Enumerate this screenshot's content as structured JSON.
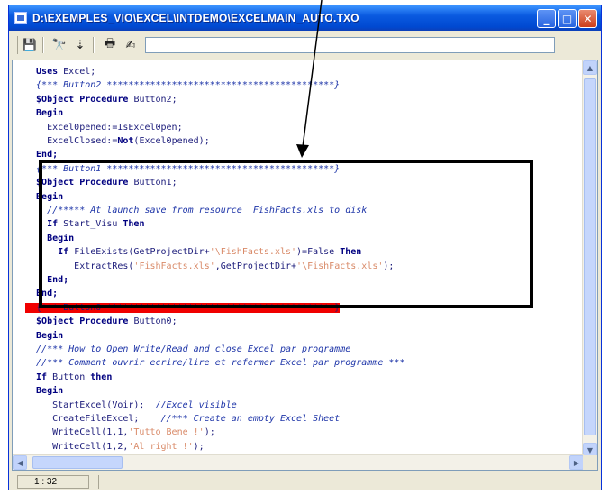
{
  "window": {
    "title": "D:\\EXEMPLES_VIO\\EXCEL\\INTDEMO\\EXCELMAIN_AUTO.TXO"
  },
  "titlebar_buttons": {
    "minimize": "_",
    "maximize": "□",
    "close": "✕"
  },
  "toolbar": {
    "icons": [
      "save-icon",
      "binoculars-icon",
      "find-next-icon",
      "print-icon",
      "edit-tool-icon"
    ],
    "glyphs": {
      "save": "💾",
      "find": "🔭",
      "find_next": "⇣",
      "print": "🖶",
      "tool": "✍"
    }
  },
  "code_lines": [
    [
      {
        "t": "  Uses ",
        "c": "kw"
      },
      {
        "t": "Excel;",
        "c": ""
      }
    ],
    [
      {
        "t": "  {*** Button2 ******************************************}",
        "c": "cm"
      }
    ],
    [
      {
        "t": "  $Object ",
        "c": "kw"
      },
      {
        "t": "Procedure ",
        "c": "kw"
      },
      {
        "t": "Button2;",
        "c": ""
      }
    ],
    [
      {
        "t": "  Begin",
        "c": "kw"
      }
    ],
    [
      {
        "t": "    Excel0pened:=IsExcel0pen;",
        "c": ""
      }
    ],
    [
      {
        "t": "    ExcelClosed:=",
        "c": ""
      },
      {
        "t": "Not",
        "c": "kw"
      },
      {
        "t": "(Excel0pened);",
        "c": ""
      }
    ],
    [
      {
        "t": "  End;",
        "c": "kw"
      }
    ],
    [
      {
        "t": "  {*** Button1 ******************************************}",
        "c": "cm"
      }
    ],
    [
      {
        "t": "  $Object ",
        "c": "kw"
      },
      {
        "t": "Procedure ",
        "c": "kw"
      },
      {
        "t": "Button1;",
        "c": ""
      }
    ],
    [
      {
        "t": "  Begin",
        "c": "kw"
      }
    ],
    [
      {
        "t": "    //***** At launch save from resource  FishFacts.xls to disk",
        "c": "cm"
      }
    ],
    [
      {
        "t": "    If ",
        "c": "kw"
      },
      {
        "t": "Start_Visu ",
        "c": ""
      },
      {
        "t": "Then",
        "c": "kw"
      }
    ],
    [
      {
        "t": "    Begin",
        "c": "kw"
      }
    ],
    [
      {
        "t": "      If ",
        "c": "kw"
      },
      {
        "t": "FileExists(GetProjectDir+",
        "c": ""
      },
      {
        "t": "'\\FishFacts.xls'",
        "c": "str"
      },
      {
        "t": ")=False ",
        "c": ""
      },
      {
        "t": "Then",
        "c": "kw"
      }
    ],
    [
      {
        "t": "         ExtractRes(",
        "c": ""
      },
      {
        "t": "'FishFacts.xls'",
        "c": "str"
      },
      {
        "t": ",GetProjectDir+",
        "c": ""
      },
      {
        "t": "'\\FishFacts.xls'",
        "c": "str"
      },
      {
        "t": ");",
        "c": ""
      }
    ],
    [
      {
        "t": "    End;",
        "c": "kw"
      }
    ],
    [
      {
        "t": "  End;",
        "c": "kw"
      }
    ],
    [
      {
        "t": "  {*** Button0 ******************************************}",
        "c": "hl"
      }
    ],
    [
      {
        "t": "  $Object ",
        "c": "kw"
      },
      {
        "t": "Procedure ",
        "c": "kw"
      },
      {
        "t": "Button0;",
        "c": ""
      }
    ],
    [
      {
        "t": "  Begin",
        "c": "kw"
      }
    ],
    [
      {
        "t": "  //*** How to Open Write/Read and close Excel par programme",
        "c": "cm"
      }
    ],
    [
      {
        "t": "  //*** Comment ouvrir ecrire/lire et refermer Excel par programme ***",
        "c": "cm"
      }
    ],
    [
      {
        "t": "  If ",
        "c": "kw"
      },
      {
        "t": "Button ",
        "c": ""
      },
      {
        "t": "then",
        "c": "kw"
      }
    ],
    [
      {
        "t": "  Begin",
        "c": "kw"
      }
    ],
    [
      {
        "t": "     StartExcel(Voir);  ",
        "c": ""
      },
      {
        "t": "//Excel visible",
        "c": "cm"
      }
    ],
    [
      {
        "t": "     CreateFileExcel;    ",
        "c": ""
      },
      {
        "t": "//*** Create an empty Excel Sheet",
        "c": "cm"
      }
    ],
    [
      {
        "t": "     WriteCell(1,1,",
        "c": ""
      },
      {
        "t": "'Tutto Bene !'",
        "c": "str"
      },
      {
        "t": ");",
        "c": ""
      }
    ],
    [
      {
        "t": "     WriteCell(1,2,",
        "c": ""
      },
      {
        "t": "'Al right !'",
        "c": "str"
      },
      {
        "t": ");",
        "c": ""
      }
    ]
  ],
  "status": {
    "position": "1 : 32"
  }
}
